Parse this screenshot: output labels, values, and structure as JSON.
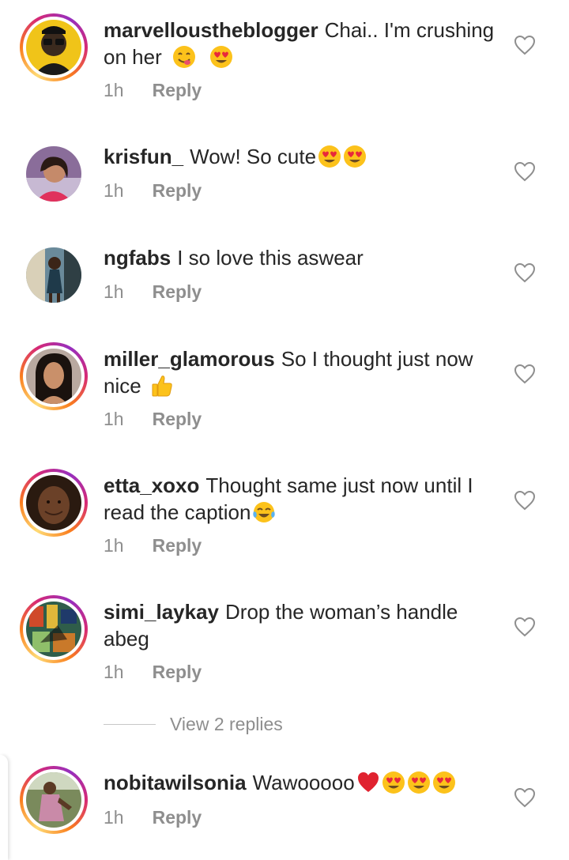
{
  "comments": [
    {
      "username": "marvelloustheblogger",
      "text": "Chai.. I'm crushing on her",
      "emojis": [
        "yum",
        "heart-eyes"
      ],
      "time": "1h",
      "reply_label": "Reply",
      "story_ring": true,
      "avatar_bg": "#f0c419"
    },
    {
      "username": "krisfun_",
      "text": "Wow! So cute",
      "emojis": [
        "heart-eyes",
        "heart-eyes"
      ],
      "time": "1h",
      "reply_label": "Reply",
      "story_ring": false,
      "avatar_bg": "#8a6d9a"
    },
    {
      "username": "ngfabs",
      "text": "I so love this aswear",
      "emojis": [],
      "time": "1h",
      "reply_label": "Reply",
      "story_ring": false,
      "avatar_bg": "#4a6b7a"
    },
    {
      "username": "miller_glamorous",
      "text": "So I thought just now nice",
      "emojis": [
        "thumbs-up"
      ],
      "time": "1h",
      "reply_label": "Reply",
      "story_ring": true,
      "avatar_bg": "#3a2a28"
    },
    {
      "username": "etta_xoxo",
      "text": "Thought same just now until I read the caption",
      "emojis": [
        "joy"
      ],
      "time": "1h",
      "reply_label": "Reply",
      "story_ring": true,
      "avatar_bg": "#5b3a26"
    },
    {
      "username": "simi_laykay",
      "text": "Drop the woman’s handle abeg",
      "emojis": [],
      "time": "1h",
      "reply_label": "Reply",
      "story_ring": true,
      "avatar_bg": "#2f5d4a"
    },
    {
      "username": "nobitawilsonia",
      "text": "Wawooooo",
      "emojis": [
        "red-heart",
        "heart-eyes",
        "heart-eyes",
        "heart-eyes"
      ],
      "time": "1h",
      "reply_label": "Reply",
      "story_ring": true,
      "avatar_bg": "#7a8a5c"
    }
  ],
  "view_replies_label": "View 2 replies",
  "colors": {
    "text": "#262626",
    "muted": "#8e8e8e",
    "ring_start": "#feda75",
    "ring_mid": "#d62976",
    "ring_end": "#962fbf"
  },
  "icons": {
    "like": "heart-outline-icon"
  }
}
